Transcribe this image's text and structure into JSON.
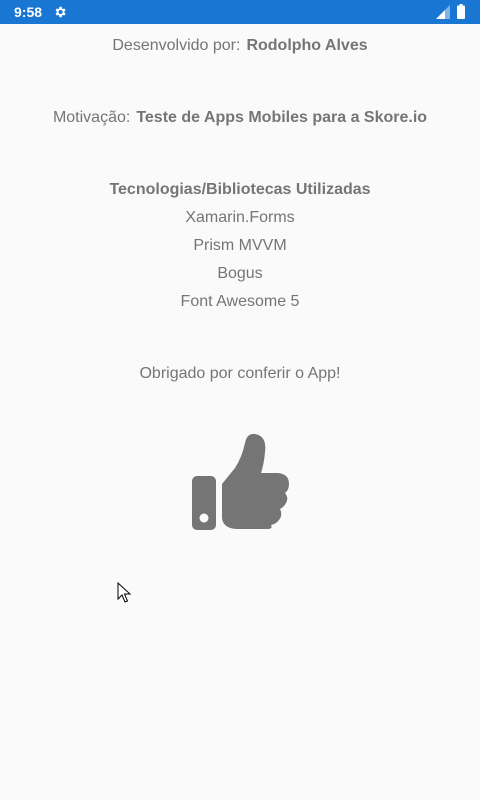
{
  "status_bar": {
    "time": "9:58",
    "icons": [
      "gear-icon",
      "signal-icon",
      "battery-icon"
    ],
    "background_color": "#1976d2"
  },
  "about": {
    "developer_label": "Desenvolvido por:",
    "developer_name": "Rodolpho Alves",
    "motivation_label": "Motivação:",
    "motivation_text": "Teste de Apps Mobiles para a Skore.io",
    "technologies_title": "Tecnologias/Bibliotecas Utilizadas",
    "technologies": [
      "Xamarin.Forms",
      "Prism MVVM",
      "Bogus",
      "Font Awesome 5"
    ],
    "thanks_text": "Obrigado por conferir o App!",
    "thanks_icon": "thumbs-up-icon",
    "text_color": "#757575"
  }
}
